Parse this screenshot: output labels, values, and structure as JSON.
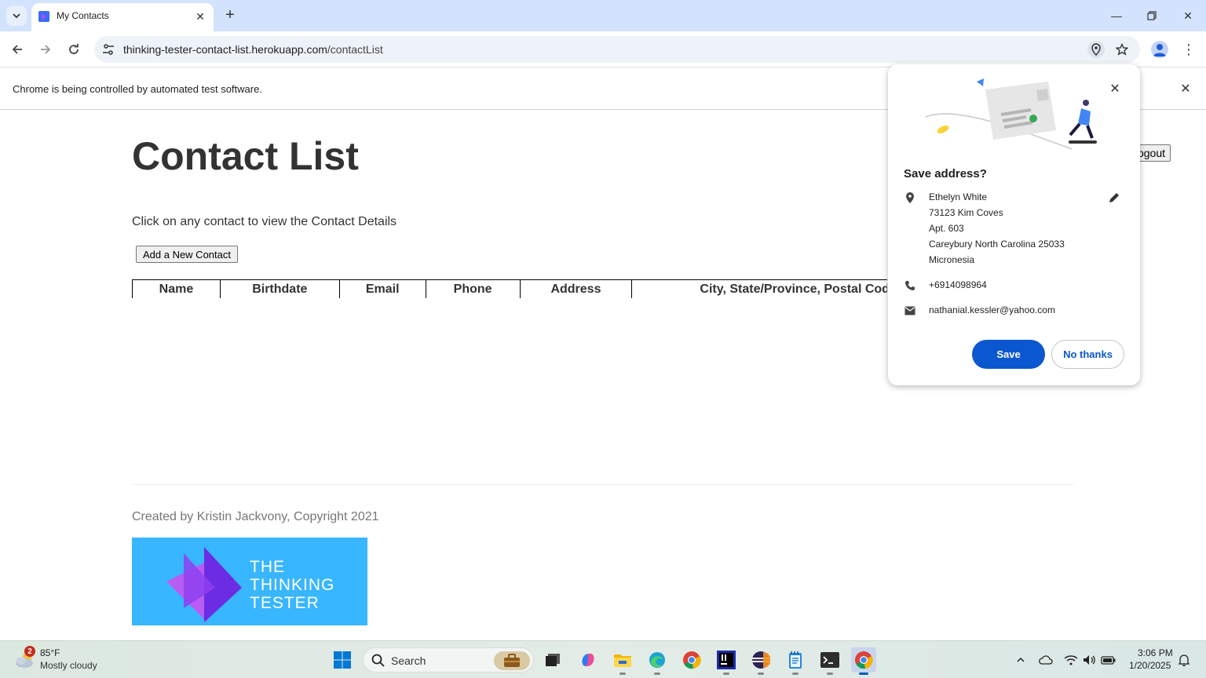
{
  "browser": {
    "tab_title": "My Contacts",
    "url_host": "thinking-tester-contact-list.herokuapp.com",
    "url_path": "/contactList",
    "infobar_text": "Chrome is being controlled by automated test software."
  },
  "page": {
    "title": "Contact List",
    "logout_label": "Logout",
    "instructions": "Click on any contact to view the Contact Details",
    "add_button": "Add a New Contact",
    "table_headers": [
      "Name",
      "Birthdate",
      "Email",
      "Phone",
      "Address",
      "City, State/Province, Postal Code"
    ],
    "footer_text": "Created by Kristin Jackvony, Copyright 2021",
    "logo_lines": [
      "The",
      "Thinking",
      "Tester"
    ]
  },
  "popup": {
    "title": "Save address?",
    "name": "Ethelyn White",
    "address_lines": [
      "73123 Kim Coves",
      "Apt. 603",
      "Careybury North Carolina 25033",
      "Micronesia"
    ],
    "phone": "+6914098964",
    "email": "nathanial.kessler@yahoo.com",
    "save_label": "Save",
    "no_thanks_label": "No thanks"
  },
  "taskbar": {
    "weather_badge": "2",
    "weather_temp": "85°F",
    "weather_desc": "Mostly cloudy",
    "search_label": "Search",
    "time": "3:06 PM",
    "date": "1/20/2025"
  },
  "colors": {
    "accent": "#0b57d0",
    "tabstrip": "#d3e3fd",
    "logo_bg": "#38b6ff"
  }
}
